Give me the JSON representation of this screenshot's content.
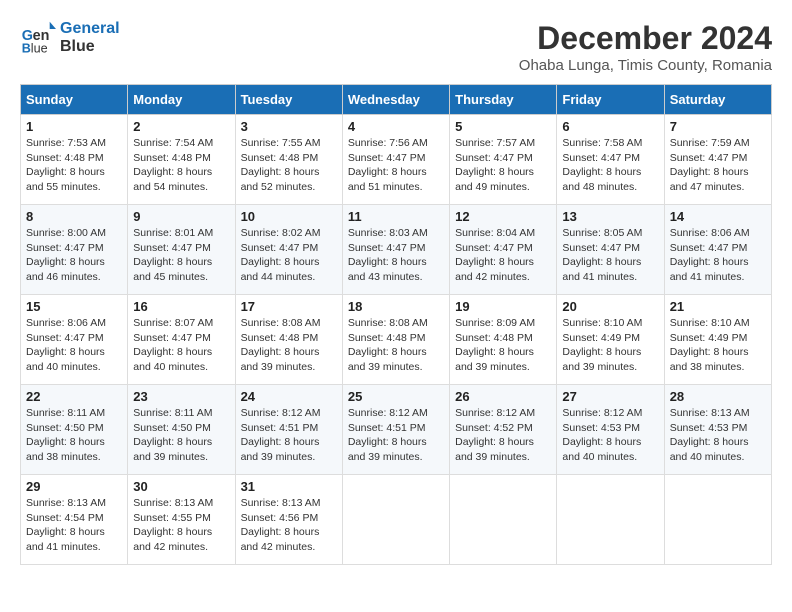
{
  "header": {
    "logo_line1": "General",
    "logo_line2": "Blue",
    "title": "December 2024",
    "subtitle": "Ohaba Lunga, Timis County, Romania"
  },
  "days_of_week": [
    "Sunday",
    "Monday",
    "Tuesday",
    "Wednesday",
    "Thursday",
    "Friday",
    "Saturday"
  ],
  "weeks": [
    [
      {
        "day": "1",
        "info": "Sunrise: 7:53 AM\nSunset: 4:48 PM\nDaylight: 8 hours and 55 minutes."
      },
      {
        "day": "2",
        "info": "Sunrise: 7:54 AM\nSunset: 4:48 PM\nDaylight: 8 hours and 54 minutes."
      },
      {
        "day": "3",
        "info": "Sunrise: 7:55 AM\nSunset: 4:48 PM\nDaylight: 8 hours and 52 minutes."
      },
      {
        "day": "4",
        "info": "Sunrise: 7:56 AM\nSunset: 4:47 PM\nDaylight: 8 hours and 51 minutes."
      },
      {
        "day": "5",
        "info": "Sunrise: 7:57 AM\nSunset: 4:47 PM\nDaylight: 8 hours and 49 minutes."
      },
      {
        "day": "6",
        "info": "Sunrise: 7:58 AM\nSunset: 4:47 PM\nDaylight: 8 hours and 48 minutes."
      },
      {
        "day": "7",
        "info": "Sunrise: 7:59 AM\nSunset: 4:47 PM\nDaylight: 8 hours and 47 minutes."
      }
    ],
    [
      {
        "day": "8",
        "info": "Sunrise: 8:00 AM\nSunset: 4:47 PM\nDaylight: 8 hours and 46 minutes."
      },
      {
        "day": "9",
        "info": "Sunrise: 8:01 AM\nSunset: 4:47 PM\nDaylight: 8 hours and 45 minutes."
      },
      {
        "day": "10",
        "info": "Sunrise: 8:02 AM\nSunset: 4:47 PM\nDaylight: 8 hours and 44 minutes."
      },
      {
        "day": "11",
        "info": "Sunrise: 8:03 AM\nSunset: 4:47 PM\nDaylight: 8 hours and 43 minutes."
      },
      {
        "day": "12",
        "info": "Sunrise: 8:04 AM\nSunset: 4:47 PM\nDaylight: 8 hours and 42 minutes."
      },
      {
        "day": "13",
        "info": "Sunrise: 8:05 AM\nSunset: 4:47 PM\nDaylight: 8 hours and 41 minutes."
      },
      {
        "day": "14",
        "info": "Sunrise: 8:06 AM\nSunset: 4:47 PM\nDaylight: 8 hours and 41 minutes."
      }
    ],
    [
      {
        "day": "15",
        "info": "Sunrise: 8:06 AM\nSunset: 4:47 PM\nDaylight: 8 hours and 40 minutes."
      },
      {
        "day": "16",
        "info": "Sunrise: 8:07 AM\nSunset: 4:47 PM\nDaylight: 8 hours and 40 minutes."
      },
      {
        "day": "17",
        "info": "Sunrise: 8:08 AM\nSunset: 4:48 PM\nDaylight: 8 hours and 39 minutes."
      },
      {
        "day": "18",
        "info": "Sunrise: 8:08 AM\nSunset: 4:48 PM\nDaylight: 8 hours and 39 minutes."
      },
      {
        "day": "19",
        "info": "Sunrise: 8:09 AM\nSunset: 4:48 PM\nDaylight: 8 hours and 39 minutes."
      },
      {
        "day": "20",
        "info": "Sunrise: 8:10 AM\nSunset: 4:49 PM\nDaylight: 8 hours and 39 minutes."
      },
      {
        "day": "21",
        "info": "Sunrise: 8:10 AM\nSunset: 4:49 PM\nDaylight: 8 hours and 38 minutes."
      }
    ],
    [
      {
        "day": "22",
        "info": "Sunrise: 8:11 AM\nSunset: 4:50 PM\nDaylight: 8 hours and 38 minutes."
      },
      {
        "day": "23",
        "info": "Sunrise: 8:11 AM\nSunset: 4:50 PM\nDaylight: 8 hours and 39 minutes."
      },
      {
        "day": "24",
        "info": "Sunrise: 8:12 AM\nSunset: 4:51 PM\nDaylight: 8 hours and 39 minutes."
      },
      {
        "day": "25",
        "info": "Sunrise: 8:12 AM\nSunset: 4:51 PM\nDaylight: 8 hours and 39 minutes."
      },
      {
        "day": "26",
        "info": "Sunrise: 8:12 AM\nSunset: 4:52 PM\nDaylight: 8 hours and 39 minutes."
      },
      {
        "day": "27",
        "info": "Sunrise: 8:12 AM\nSunset: 4:53 PM\nDaylight: 8 hours and 40 minutes."
      },
      {
        "day": "28",
        "info": "Sunrise: 8:13 AM\nSunset: 4:53 PM\nDaylight: 8 hours and 40 minutes."
      }
    ],
    [
      {
        "day": "29",
        "info": "Sunrise: 8:13 AM\nSunset: 4:54 PM\nDaylight: 8 hours and 41 minutes."
      },
      {
        "day": "30",
        "info": "Sunrise: 8:13 AM\nSunset: 4:55 PM\nDaylight: 8 hours and 42 minutes."
      },
      {
        "day": "31",
        "info": "Sunrise: 8:13 AM\nSunset: 4:56 PM\nDaylight: 8 hours and 42 minutes."
      },
      null,
      null,
      null,
      null
    ]
  ]
}
